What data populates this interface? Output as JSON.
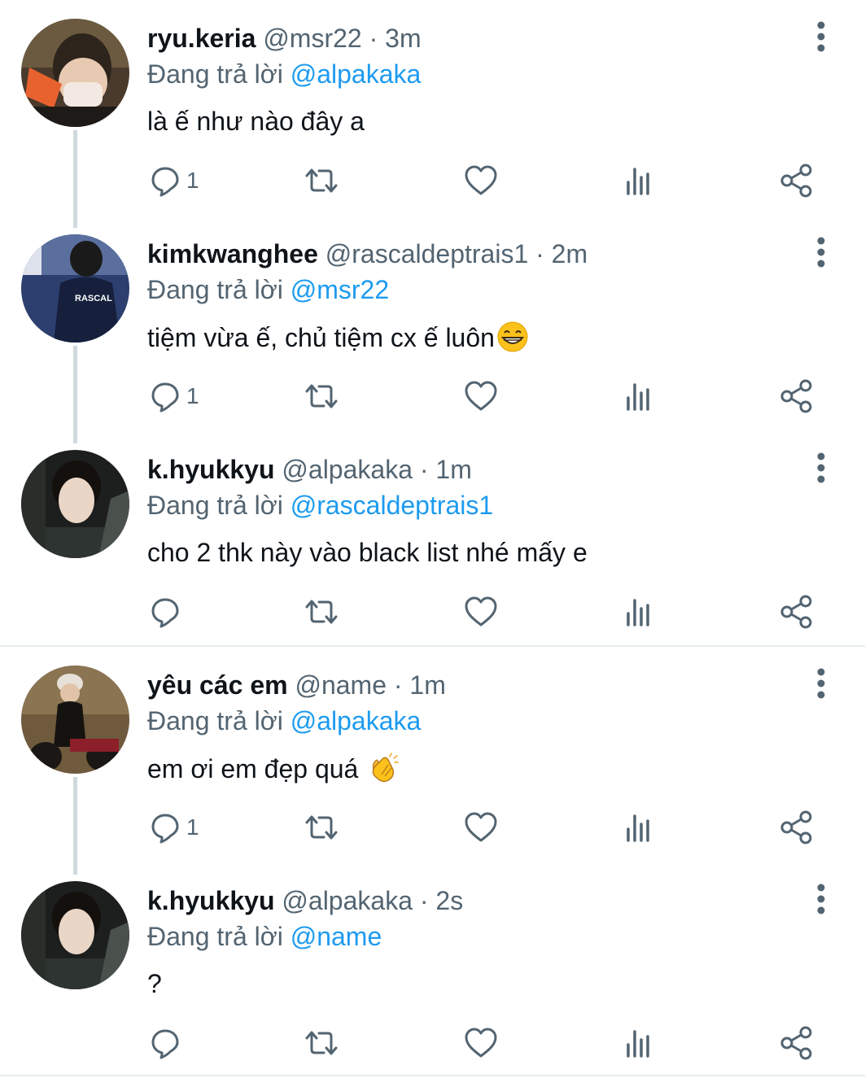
{
  "reply_prefix": "Đang trả lời",
  "tweets": [
    {
      "name": "ryu.keria",
      "handle": "@msr22",
      "time": "3m",
      "reply_to": "@alpakaka",
      "text": "là ế như nào đây a",
      "reply_count": "1",
      "avatar": "avatar-orange-mask"
    },
    {
      "name": "kimkwanghee",
      "handle": "@rascaldeptrais1",
      "time": "2m",
      "reply_to": "@msr22",
      "text": "tiệm vừa ế, chủ tiệm cx ế luôn",
      "emoji": "grinning-face-emoji",
      "reply_count": "1",
      "avatar": "avatar-rascal-jacket"
    },
    {
      "name": "k.hyukkyu",
      "handle": "@alpakaka",
      "time": "1m",
      "reply_to": "@rascaldeptrais1",
      "text": "cho 2 thk này vào black list nhé mấy e",
      "reply_count": "",
      "avatar": "avatar-portrait"
    },
    {
      "name": "yêu các em",
      "handle": "@name",
      "time": "1m",
      "reply_to": "@alpakaka",
      "text": "em ơi em đẹp quá ",
      "emoji": "clapping-hands-emoji",
      "reply_count": "1",
      "avatar": "avatar-motorbike"
    },
    {
      "name": "k.hyukkyu",
      "handle": "@alpakaka",
      "time": "2s",
      "reply_to": "@name",
      "text": "?",
      "reply_count": "",
      "avatar": "avatar-portrait"
    }
  ],
  "action_icons": [
    "reply-icon",
    "retweet-icon",
    "like-icon",
    "analytics-icon",
    "share-icon"
  ],
  "colors": {
    "mention": "#1d9bf0",
    "secondary": "#536471",
    "text": "#0f1419",
    "thread_line": "#cfd9de"
  }
}
